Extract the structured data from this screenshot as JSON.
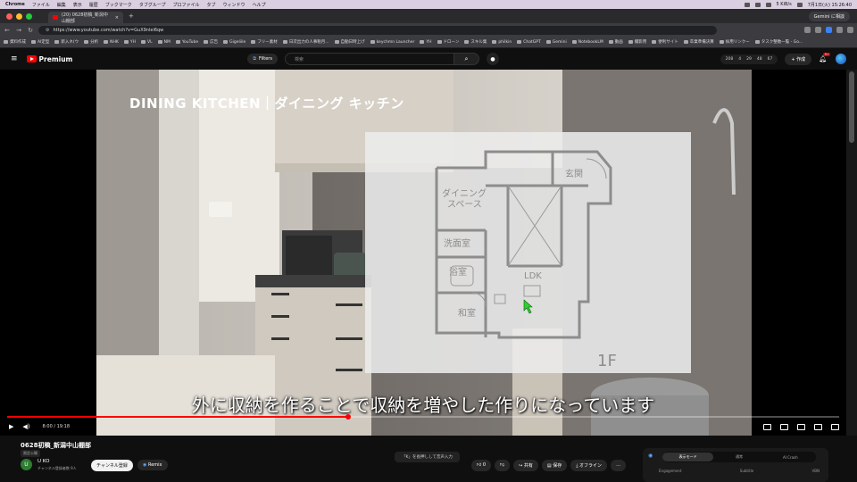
{
  "menubar": {
    "app": "Chrome",
    "items": [
      "ファイル",
      "編集",
      "表示",
      "履歴",
      "ブックマーク",
      "タブグループ",
      "プロファイル",
      "タブ",
      "ウィンドウ",
      "ヘルプ"
    ],
    "battery": "5 KiB/s",
    "datetime": "7月1日(火) 15:26:40"
  },
  "browser": {
    "tab_title": "(20) 0628初稿_新潟中山棚部",
    "new_tab": "+",
    "gemini": "Gemini に相談",
    "url": "https://www.youtube.com/watch?v=GuX9nlei6qw",
    "bookmarks": [
      "資料作成",
      "AI定型",
      "新入ネ(ウ",
      "分析",
      "NHK",
      "YH",
      "VL",
      "NM",
      "YouTube",
      "広告",
      "Gigeliile",
      "フリー素材",
      "日次出力の人事税月...",
      "自動日時上げ",
      "keychmn Launcher",
      "YH",
      "ドローン",
      "スキル集",
      "philkin",
      "ChatGPT",
      "Gemini",
      "NotebookLM",
      "動画",
      "撮影用",
      "便利サイト",
      "卒業準備決算",
      "採用リンクー",
      "タスク整数一覧 - Go..."
    ]
  },
  "youtube": {
    "logo": "Premium",
    "filters": "Filters",
    "search_placeholder": "検索",
    "stats": [
      "208",
      "4",
      "29",
      "48",
      "67"
    ],
    "create": "+ 作成",
    "notif_count": "9+"
  },
  "video": {
    "heading": "DINING KITCHEN｜ダイニング キッチン",
    "subtitle": "外に収納を作ることで収納を増やした作りになっています",
    "time": "8:00 / 19:18",
    "progress": 0.41,
    "floorplan": {
      "rooms": [
        "ダイニング",
        "スペース",
        "玄関",
        "洗面室",
        "浴室",
        "LDK",
        "和室"
      ],
      "floor_label": "1F"
    }
  },
  "below": {
    "title": "0628初稿_新潟中山棚部",
    "visibility": "限定公開",
    "channel_initial": "U",
    "channel": "U KO",
    "subs": "チャンネル登録者数 9人",
    "subscribe": "チャンネル登録",
    "remix": "Remix",
    "hint": "「K」を長押しして音声入力",
    "likes": "0",
    "share": "共有",
    "save": "保存",
    "offline": "オフライン",
    "more": "…",
    "modes": [
      "表示モード",
      "通常",
      "AI Crash"
    ],
    "mode_labels": [
      "Engagement",
      "Subtitle",
      "VBN"
    ]
  }
}
